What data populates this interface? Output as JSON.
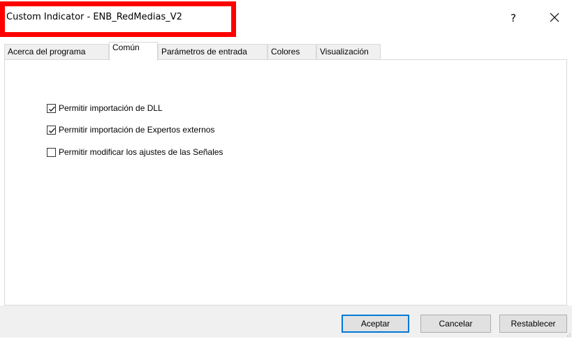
{
  "window": {
    "title": "Custom Indicator - ENB_RedMedias_V2",
    "help_glyph": "?",
    "close_icon": "close-icon",
    "highlight_color": "#ff0000"
  },
  "tabs": [
    {
      "label": "Acerca del programa",
      "active": false
    },
    {
      "label": "Común",
      "active": true
    },
    {
      "label": "Parámetros de entrada",
      "active": false
    },
    {
      "label": "Colores",
      "active": false
    },
    {
      "label": "Visualización",
      "active": false
    }
  ],
  "options": [
    {
      "label": "Permitir importación de DLL",
      "checked": true
    },
    {
      "label": "Permitir importación de Expertos externos",
      "checked": true
    },
    {
      "label": "Permitir modificar los ajustes de las Señales",
      "checked": false
    }
  ],
  "buttons": {
    "accept": "Aceptar",
    "cancel": "Cancelar",
    "reset": "Restablecer"
  },
  "colors": {
    "accent": "#0078d7",
    "footer_bg": "#f0f0f0"
  }
}
